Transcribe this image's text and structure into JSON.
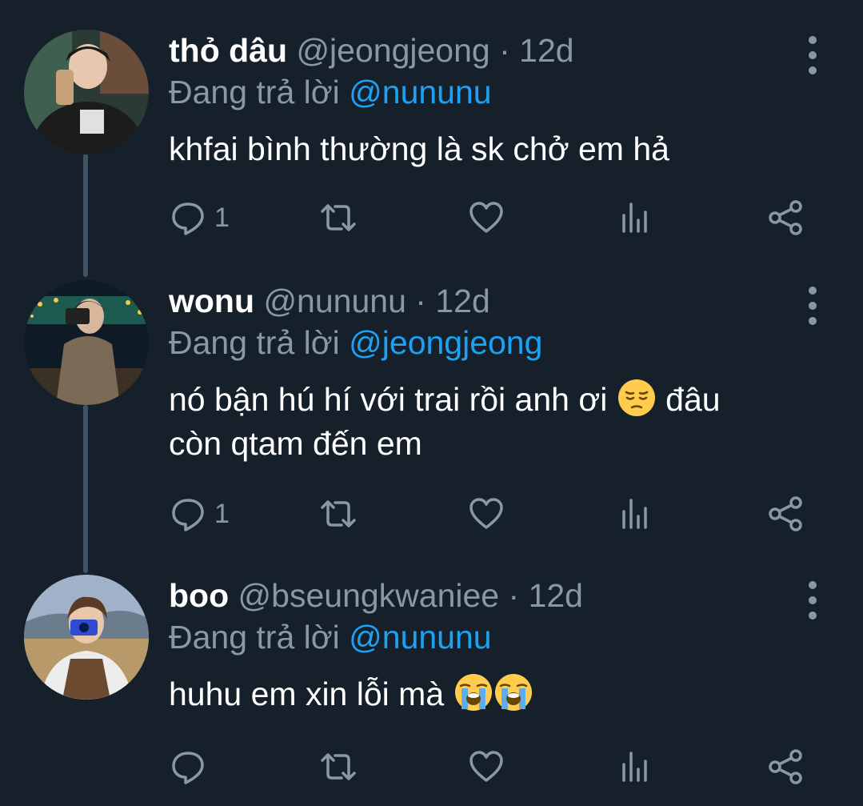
{
  "colors": {
    "background": "#15202b",
    "muted": "#8899a6",
    "accent": "#1da1f2",
    "thread_line": "#3d5466"
  },
  "reply_prefix": "Đang trả lời",
  "tweets": [
    {
      "name": "thỏ dâu",
      "handle": "@jeongjeong",
      "separator": "·",
      "time": "12d",
      "reply_to": "@nununu",
      "text_lines": [
        "khfai bình thường là sk chở em hả"
      ],
      "reply_count": "1",
      "icons": [
        "reply-icon",
        "retweet-icon",
        "like-icon",
        "analytics-icon",
        "share-icon"
      ]
    },
    {
      "name": "wonu",
      "handle": "@nununu",
      "separator": "·",
      "time": "12d",
      "reply_to": "@jeongjeong",
      "text_line1_before": "nó bận hú hí với trai rồi anh ơi",
      "text_line1_emoji": "pensive-face-emoji",
      "text_line1_after": "đâu",
      "text_line2": "còn qtam đến em",
      "reply_count": "1"
    },
    {
      "name": "boo",
      "handle": "@bseungkwaniee",
      "separator": "·",
      "time": "12d",
      "reply_to": "@nununu",
      "text": "huhu em xin lỗi mà",
      "text_emojis": [
        "loudly-crying-face-emoji",
        "loudly-crying-face-emoji"
      ],
      "reply_count": ""
    }
  ]
}
